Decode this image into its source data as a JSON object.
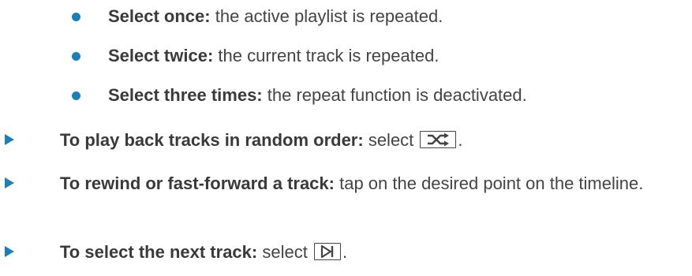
{
  "repeat_options": [
    {
      "label": "Select once:",
      "text": " the active playlist is repeated."
    },
    {
      "label": "Select twice:",
      "text": " the current track is repeated."
    },
    {
      "label": "Select three times:",
      "text": " the repeat function is deactivated."
    }
  ],
  "instructions": [
    {
      "label": "To play back tracks in random order:",
      "text_before": " select ",
      "icon": "shuffle-icon",
      "text_after": "."
    },
    {
      "label": "To rewind or fast-forward a track:",
      "text": " tap on the desired point on the timeline."
    },
    {
      "label": "To select the next track:",
      "text_before": " select ",
      "icon": "next-track-icon",
      "text_after": "."
    }
  ],
  "colors": {
    "accent": "#1c7fb9",
    "text": "#3a3a3a"
  }
}
